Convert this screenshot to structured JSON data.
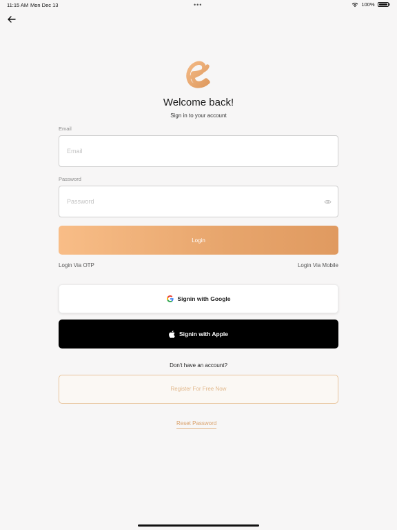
{
  "status_bar": {
    "time": "11:15 AM",
    "date": "Mon Dec 13",
    "battery_text": "100%",
    "battery_level": 1.0,
    "wifi_icon": "wifi-icon",
    "dots": "•••"
  },
  "header": {
    "back_icon": "arrow-left-icon"
  },
  "branding": {
    "logo_icon": "brand-e-logo",
    "logo_color": "#e9a56e"
  },
  "welcome": {
    "title": "Welcome back!",
    "subtitle": "Sign in to your account"
  },
  "form": {
    "email": {
      "label": "Email",
      "placeholder": "Email",
      "value": ""
    },
    "password": {
      "label": "Password",
      "placeholder": "Password",
      "value": "",
      "toggle_icon": "eye-icon"
    },
    "login_label": "Login",
    "login_gradient": [
      "#f8bd87",
      "#e09a60"
    ]
  },
  "alt_login": {
    "otp_label": "Login Via OTP",
    "mobile_label": "Login Via Mobile"
  },
  "social": {
    "google_label": "Signin with Google",
    "google_icon": "google-icon",
    "apple_label": "Signin with Apple",
    "apple_icon": "apple-icon"
  },
  "register": {
    "prompt": "Don't have an account?",
    "button_label": "Register For Free Now",
    "accent": "#e2b88c"
  },
  "reset": {
    "label": "Reset Password"
  }
}
